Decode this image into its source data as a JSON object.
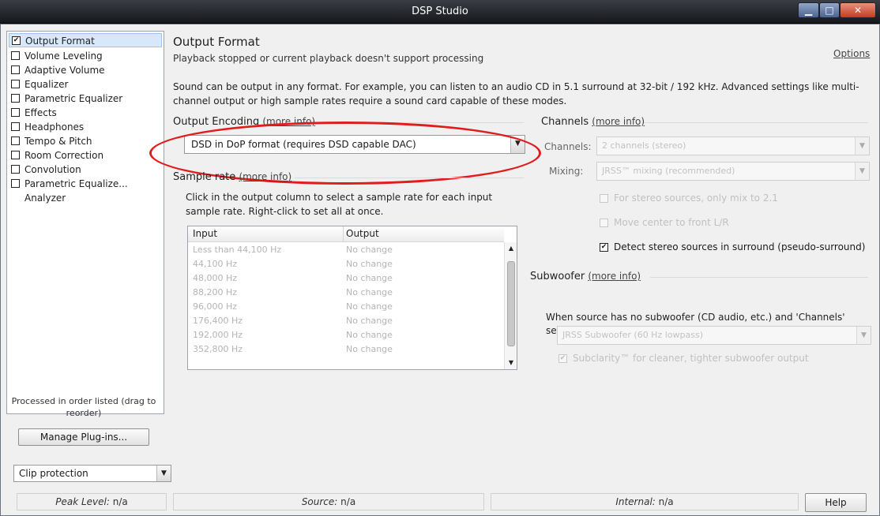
{
  "window": {
    "title": "DSP Studio"
  },
  "sidebar": {
    "items": [
      {
        "label": "Output Format",
        "checked": true,
        "selected": true
      },
      {
        "label": "Volume Leveling",
        "checked": false
      },
      {
        "label": "Adaptive Volume",
        "checked": false
      },
      {
        "label": "Equalizer",
        "checked": false
      },
      {
        "label": "Parametric Equalizer",
        "checked": false
      },
      {
        "label": "Effects",
        "checked": false
      },
      {
        "label": "Headphones",
        "checked": false
      },
      {
        "label": "Tempo & Pitch",
        "checked": false
      },
      {
        "label": "Room Correction",
        "checked": false
      },
      {
        "label": "Convolution",
        "checked": false
      },
      {
        "label": "Parametric Equalize...",
        "checked": false
      },
      {
        "label": "Analyzer",
        "checked": null
      }
    ],
    "order_note": "Processed in order listed (drag to reorder)",
    "manage_label": "Manage Plug-ins...",
    "clip_value": "Clip protection"
  },
  "main": {
    "title": "Output Format",
    "subtitle": "Playback stopped or current playback doesn't support processing",
    "options_label": "Options",
    "description": "Sound can be output in any format. For example, you can listen to an audio CD in 5.1 surround at 32-bit / 192 kHz. Advanced settings like multi-channel output or high sample rates require a sound card capable of these modes."
  },
  "encoding": {
    "heading": "Output Encoding",
    "link": "(more info)",
    "value": "DSD in DoP format (requires DSD capable DAC)"
  },
  "sample_rate": {
    "heading": "Sample rate",
    "link": "(more info)",
    "hint": "Click in the output column to select a sample rate for each input sample rate. Right-click to set all at once.",
    "columns": [
      "Input",
      "Output"
    ],
    "rows": [
      {
        "input": "Less than 44,100 Hz",
        "output": "No change"
      },
      {
        "input": "44,100 Hz",
        "output": "No change"
      },
      {
        "input": "48,000 Hz",
        "output": "No change"
      },
      {
        "input": "88,200 Hz",
        "output": "No change"
      },
      {
        "input": "96,000 Hz",
        "output": "No change"
      },
      {
        "input": "176,400 Hz",
        "output": "No change"
      },
      {
        "input": "192,000 Hz",
        "output": "No change"
      },
      {
        "input": "352,800 Hz",
        "output": "No change"
      }
    ]
  },
  "channels": {
    "heading": "Channels",
    "link": "(more info)",
    "channels_label": "Channels:",
    "channels_value": "2 channels (stereo)",
    "mixing_label": "Mixing:",
    "mixing_value": "JRSS™ mixing (recommended)",
    "opt_stereo_21": "For stereo sources, only mix to 2.1",
    "opt_center": "Move center to front L/R",
    "opt_detect": "Detect stereo sources in surround (pseudo-surround)"
  },
  "subwoofer": {
    "heading": "Subwoofer",
    "link": "(more info)",
    "note": "When source has no subwoofer (CD audio, etc.) and 'Channels' selection includes a subwoofer:",
    "select_value": "JRSS Subwoofer (60 Hz lowpass)",
    "subclarity": "Subclarity™ for cleaner, tighter subwoofer output"
  },
  "status": {
    "peak_label": "Peak Level:",
    "peak_value": "n/a",
    "source_label": "Source:",
    "source_value": "n/a",
    "internal_label": "Internal:",
    "internal_value": "n/a",
    "help_label": "Help"
  },
  "colors": {
    "highlight": "#e01d1d",
    "selection": "#d7e8fb",
    "titlebar": "#1f2126"
  }
}
